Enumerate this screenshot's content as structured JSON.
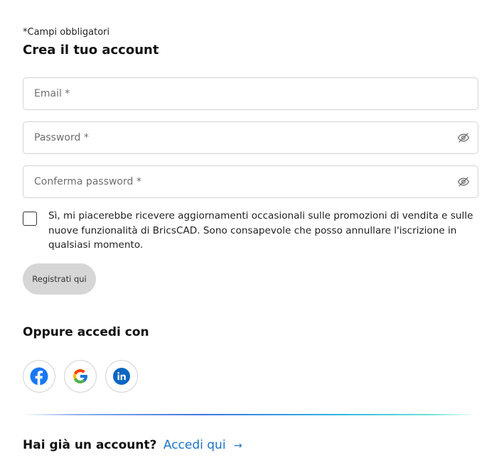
{
  "form": {
    "required_note": "*Campi obbligatori",
    "title": "Crea il tuo account",
    "email": {
      "value": "",
      "placeholder": "Email *"
    },
    "password": {
      "value": "",
      "placeholder": "Password *",
      "toggle_icon": "eye-slash-icon"
    },
    "confirm_password": {
      "value": "",
      "placeholder": "Conferma password *",
      "toggle_icon": "eye-slash-icon"
    },
    "consent": {
      "checked": false,
      "text": "Sì, mi piacerebbe ricevere aggiornamenti occasionali sulle promozioni di vendita e sulle nuove funzionalità di BricsCAD. Sono consapevole che posso annullare l'iscrizione in qualsiasi momento."
    },
    "register_label": "Registrati qui"
  },
  "social": {
    "title": "Oppure accedi con",
    "providers": [
      {
        "name": "facebook",
        "icon": "facebook-icon",
        "color": "#1877F2"
      },
      {
        "name": "google",
        "icon": "google-icon",
        "colors": [
          "#4285F4",
          "#EA4335",
          "#FBBC05",
          "#34A853"
        ]
      },
      {
        "name": "linkedin",
        "icon": "linkedin-icon",
        "color": "#0A66C2"
      }
    ]
  },
  "footer": {
    "question": "Hai già un account?",
    "link_label": "Accedi qui",
    "arrow": "→",
    "link_color": "#1a73c8"
  },
  "colors": {
    "border": "#d4d4d4",
    "button_bg": "#d6d6d6"
  }
}
